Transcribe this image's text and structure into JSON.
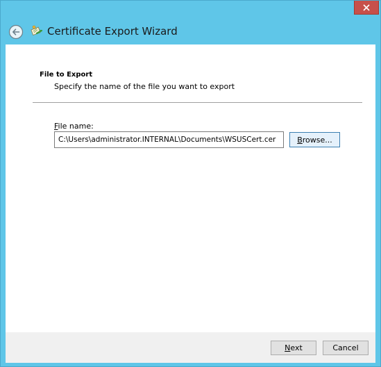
{
  "window": {
    "title": "Certificate Export Wizard",
    "close_icon": "close-icon",
    "back_icon": "back-arrow-icon",
    "wizard_icon": "certificate-icon"
  },
  "page": {
    "heading": "File to Export",
    "subheading": "Specify the name of the file you want to export"
  },
  "file_name": {
    "label_mnemonic": "F",
    "label_rest": "ile name:",
    "value": "C:\\Users\\administrator.INTERNAL\\Documents\\WSUSCert.cer"
  },
  "buttons": {
    "browse_mnemonic": "B",
    "browse_rest": "rowse...",
    "next_mnemonic": "N",
    "next_rest": "ext",
    "cancel": "Cancel"
  },
  "colors": {
    "titlebar": "#5fc6e8",
    "close_button": "#c7504a",
    "content_bg": "#ffffff",
    "footer_bg": "#f0f0f0"
  }
}
